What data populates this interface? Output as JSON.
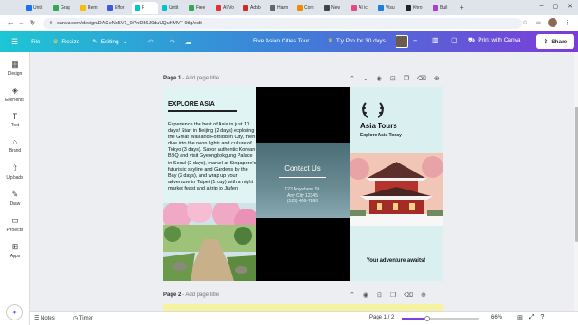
{
  "browser": {
    "tabs": [
      {
        "label": "Untit",
        "color": "#1a73e8"
      },
      {
        "label": "Grap",
        "color": "#34a853"
      },
      {
        "label": "Rem",
        "color": "#fbbc05"
      },
      {
        "label": "Effor",
        "color": "#3b5bdb"
      },
      {
        "label": "F",
        "color": "#00c4cc",
        "active": true
      },
      {
        "label": "Untit",
        "color": "#00c4cc"
      },
      {
        "label": "Free",
        "color": "#34a853"
      },
      {
        "label": "AI Vo",
        "color": "#e03131"
      },
      {
        "label": "Adob",
        "color": "#c92a2a"
      },
      {
        "label": "Harm",
        "color": "#666666"
      },
      {
        "label": "Com",
        "color": "#f08c00"
      },
      {
        "label": "New",
        "color": "#444444"
      },
      {
        "label": "AI ic",
        "color": "#e64980"
      },
      {
        "label": "Visu",
        "color": "#1c7ed6"
      },
      {
        "label": "Khro",
        "color": "#222222"
      },
      {
        "label": "Buil",
        "color": "#ae3ec9"
      }
    ],
    "new_tab": "+",
    "url": "canva.com/design/DAGeNo5V1_0/7nD86J0duUQuKMVT-9tlg/edit"
  },
  "header": {
    "file": "File",
    "resize": "Resize",
    "editing": "Editing",
    "doc_title": "Five Asian Cities Tour",
    "try_pro": "Try Pro for 30 days",
    "print": "Print with Canva",
    "share": "Share",
    "brand_colors": {
      "start": "#1ec6d4",
      "mid": "#3e7fd8",
      "end": "#7d3bd8"
    }
  },
  "sidebar": {
    "items": [
      {
        "label": "Design",
        "icon": "layout-icon"
      },
      {
        "label": "Elements",
        "icon": "shapes-icon"
      },
      {
        "label": "Text",
        "icon": "text-icon"
      },
      {
        "label": "Brand",
        "icon": "brand-icon"
      },
      {
        "label": "Uploads",
        "icon": "upload-icon"
      },
      {
        "label": "Draw",
        "icon": "pen-icon"
      },
      {
        "label": "Projects",
        "icon": "folder-icon"
      },
      {
        "label": "Apps",
        "icon": "apps-icon"
      }
    ]
  },
  "page1": {
    "label": "Page 1",
    "title_placeholder": "Add page title",
    "explore_heading": "EXPLORE ASIA",
    "body": "Experience the best of Asia in just 10 days! Start in Beijing (2 days) exploring the Great Wall and Forbidden City, then dive into the neon lights and culture of Tokyo (3 days). Savor authentic Korean BBQ and visit Gyeongbokgung Palace in Seoul (2 days), marvel at Singapore's futuristic skyline and Gardens by the Bay (2 days), and wrap up your adventure in Taipei (1 day) with a night market feast and a trip to Jiufen",
    "contact_title": "Contact Us",
    "contact_address": "123 Anywhere St.",
    "contact_city": "Any City 12345",
    "contact_phone": "(123) 456-7890",
    "brand_name": "Asia Tours",
    "brand_tagline": "Explore Asia Today",
    "adventure": "Your adventure awaits!"
  },
  "page2": {
    "label": "Page 2",
    "title_placeholder": "Add page title"
  },
  "footer": {
    "notes": "Notes",
    "timer": "Timer",
    "page_indicator": "Page 1 / 2",
    "zoom": "66%",
    "zoom_fraction": 0.33
  }
}
